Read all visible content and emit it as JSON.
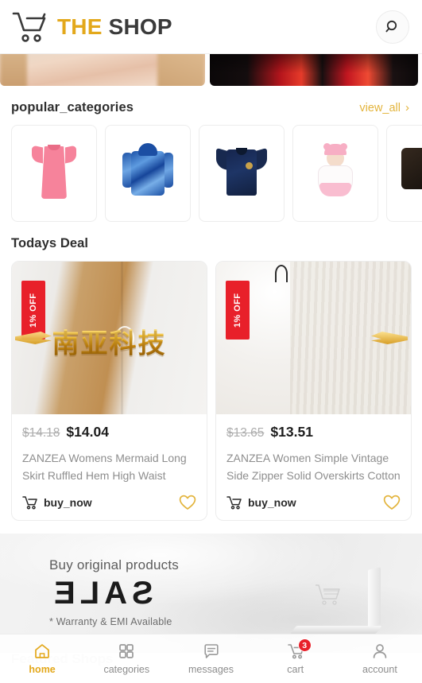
{
  "header": {
    "logo_icon": "shopping-cart-icon",
    "brand_part1": "THE",
    "brand_part2": "SHOP",
    "brand_color_1": "#E3A81B",
    "brand_color_2": "#3a3a3a",
    "search_icon": "search-icon"
  },
  "banner_carousel": {
    "slides": [
      {
        "name": "model-banner",
        "alt": ""
      },
      {
        "name": "red-dark-banner",
        "alt": ""
      }
    ]
  },
  "popular_categories": {
    "title": "popular_categories",
    "view_all_label": "view_all",
    "chevron": "›",
    "items": [
      {
        "name": "pink-dress",
        "label": ""
      },
      {
        "name": "blue-tie-dye-hoodie",
        "label": ""
      },
      {
        "name": "navy-soccer-jersey",
        "label": ""
      },
      {
        "name": "baby-doll",
        "label": ""
      },
      {
        "name": "dark-item",
        "label": ""
      }
    ]
  },
  "todays_deal": {
    "title": "Todays Deal",
    "watermark_text": "南亚科技",
    "items": [
      {
        "badge": "1% OFF",
        "price_old": "$14.18",
        "price_new": "$14.04",
        "title": "ZANZEA Womens Mermaid Long Skirt Ruffled Hem High Waist Elegant…",
        "buy_label": "buy_now",
        "cart_icon": "cart-icon",
        "wishlist_icon": "heart-icon"
      },
      {
        "badge": "1% OFF",
        "price_old": "$13.65",
        "price_new": "$13.51",
        "title": "ZANZEA Women Simple Vintage Side Zipper Solid Overskirts Cotton Loose…",
        "buy_label": "buy_now",
        "cart_icon": "cart-icon",
        "wishlist_icon": "heart-icon"
      }
    ]
  },
  "sale_banner": {
    "line1": "Buy original products",
    "word": "SALE",
    "line2": "* Warranty & EMI Available",
    "graphic": "laptop-with-cart-icon"
  },
  "featured_shops": {
    "title": "Featured Shops"
  },
  "bottom_nav": {
    "items": [
      {
        "label": "home",
        "icon": "home-icon",
        "active": true,
        "badge": ""
      },
      {
        "label": "categories",
        "icon": "grid-icon",
        "active": false,
        "badge": ""
      },
      {
        "label": "messages",
        "icon": "chat-bubble-icon",
        "active": false,
        "badge": ""
      },
      {
        "label": "cart",
        "icon": "cart-icon",
        "active": false,
        "badge": "3"
      },
      {
        "label": "account",
        "icon": "user-icon",
        "active": false,
        "badge": ""
      }
    ],
    "active_color": "#E3A81B",
    "badge_color": "#E8202A"
  }
}
